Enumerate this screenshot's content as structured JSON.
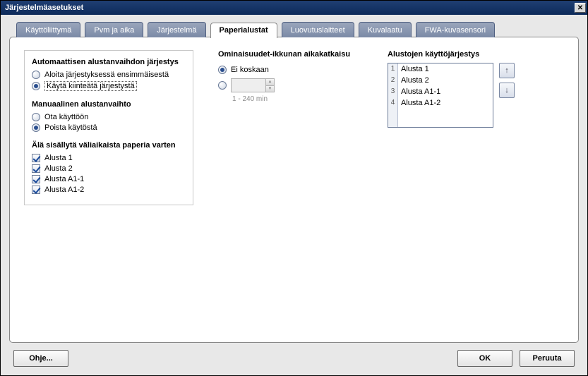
{
  "window": {
    "title": "Järjestelmäasetukset"
  },
  "tabs": {
    "ui": "Käyttöliittymä",
    "datetime": "Pvm ja aika",
    "system": "Järjestelmä",
    "trays": "Paperialustat",
    "output": "Luovutuslaitteet",
    "quality": "Kuvalaatu",
    "fwa": "FWA-kuvasensori"
  },
  "auto_switch": {
    "title": "Automaattisen alustanvaihdon järjestys",
    "opt_first": "Aloita järjestyksessä ensimmäisestä",
    "opt_fixed": "Käytä kiinteätä järjestystä"
  },
  "manual_switch": {
    "title": "Manuaalinen alustanvaihto",
    "opt_enable": "Ota käyttöön",
    "opt_disable": "Poista käytöstä"
  },
  "exclude": {
    "title": "Älä sisällytä väliaikaista paperia varten",
    "items": [
      "Alusta 1",
      "Alusta 2",
      "Alusta A1-1",
      "Alusta A1-2"
    ]
  },
  "timeout": {
    "title": "Ominaisuudet-ikkunan aikakatkaisu",
    "opt_never": "Ei koskaan",
    "hint": "1 - 240 min"
  },
  "order": {
    "title": "Alustojen käyttöjärjestys",
    "items": [
      "Alusta 1",
      "Alusta 2",
      "Alusta A1-1",
      "Alusta A1-2"
    ],
    "nums": [
      "1",
      "2",
      "3",
      "4"
    ]
  },
  "buttons": {
    "help": "Ohje...",
    "ok": "OK",
    "cancel": "Peruuta"
  }
}
